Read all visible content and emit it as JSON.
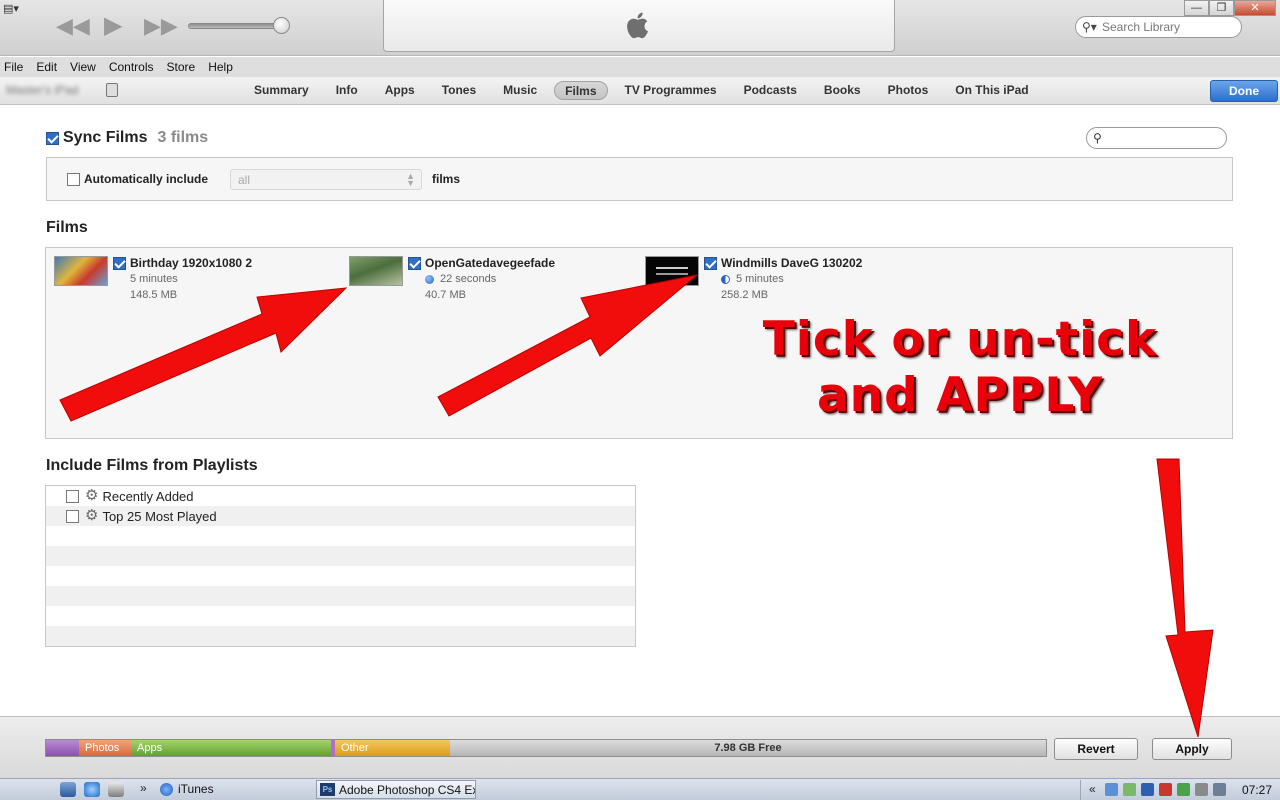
{
  "app": {
    "search_placeholder": "Search Library"
  },
  "menu": [
    "File",
    "Edit",
    "View",
    "Controls",
    "Store",
    "Help"
  ],
  "device": {
    "name": "Master's iPad",
    "tabs": [
      {
        "label": "Summary",
        "active": false
      },
      {
        "label": "Info",
        "active": false
      },
      {
        "label": "Apps",
        "active": false
      },
      {
        "label": "Tones",
        "active": false
      },
      {
        "label": "Music",
        "active": false
      },
      {
        "label": "Films",
        "active": true
      },
      {
        "label": "TV Programmes",
        "active": false
      },
      {
        "label": "Podcasts",
        "active": false
      },
      {
        "label": "Books",
        "active": false
      },
      {
        "label": "Photos",
        "active": false
      },
      {
        "label": "On This iPad",
        "active": false
      }
    ],
    "done_label": "Done"
  },
  "sync": {
    "label": "Sync Films",
    "count": "3 films",
    "checked": true
  },
  "auto_include": {
    "label": "Automatically include",
    "selected": "all",
    "suffix": "films",
    "checked": false
  },
  "films": {
    "title": "Films",
    "items": [
      {
        "title": "Birthday 1920x1080 2",
        "duration": "5 minutes",
        "size": "148.5 MB",
        "checked": true,
        "dot": ""
      },
      {
        "title": "OpenGatedavegeefade",
        "duration": "22 seconds",
        "size": "40.7 MB",
        "checked": true,
        "dot": "#3a78d8"
      },
      {
        "title": "Windmills DaveG 130202",
        "duration": "5 minutes",
        "size": "258.2 MB",
        "checked": true,
        "dot": "half"
      }
    ]
  },
  "annotation": {
    "line1": "Tick or un-tick",
    "line2": "and APPLY",
    "color": "#e8000a"
  },
  "playlists": {
    "title": "Include Films from Playlists",
    "items": [
      {
        "label": "Recently Added",
        "checked": false
      },
      {
        "label": "Top 25 Most Played",
        "checked": false
      }
    ]
  },
  "capacity": {
    "photos": "Photos",
    "apps": "Apps",
    "other": "Other",
    "free": "7.98 GB Free"
  },
  "buttons": {
    "revert": "Revert",
    "apply": "Apply"
  },
  "taskbar": {
    "chevron": "»",
    "itunes": "iTunes",
    "photoshop": "Adobe Photoshop CS4 Ex...",
    "tray_chevron": "«",
    "clock": "07:27"
  }
}
